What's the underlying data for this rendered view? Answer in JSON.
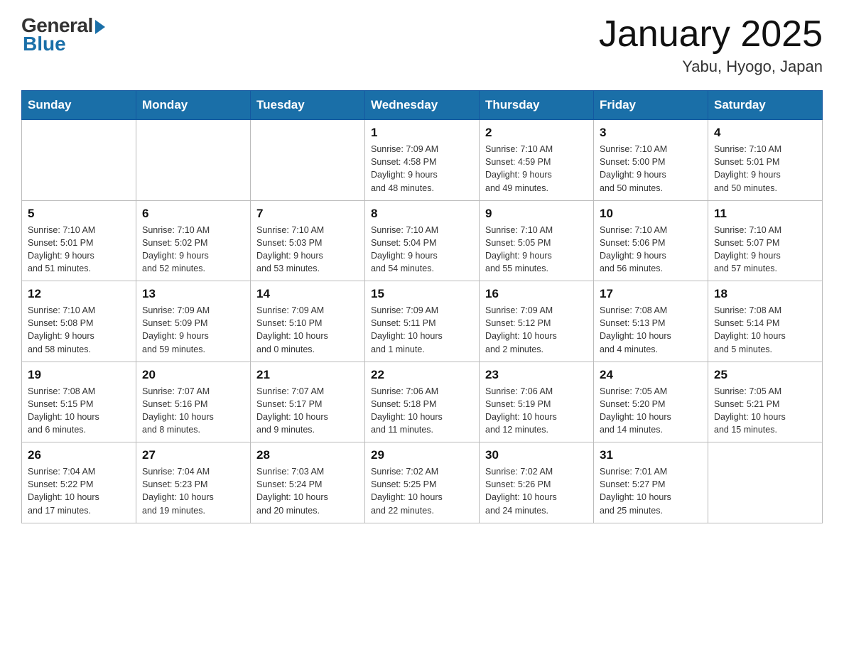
{
  "header": {
    "logo_general": "General",
    "logo_blue": "Blue",
    "title": "January 2025",
    "location": "Yabu, Hyogo, Japan"
  },
  "days_of_week": [
    "Sunday",
    "Monday",
    "Tuesday",
    "Wednesday",
    "Thursday",
    "Friday",
    "Saturday"
  ],
  "weeks": [
    [
      {
        "day": "",
        "info": ""
      },
      {
        "day": "",
        "info": ""
      },
      {
        "day": "",
        "info": ""
      },
      {
        "day": "1",
        "info": "Sunrise: 7:09 AM\nSunset: 4:58 PM\nDaylight: 9 hours\nand 48 minutes."
      },
      {
        "day": "2",
        "info": "Sunrise: 7:10 AM\nSunset: 4:59 PM\nDaylight: 9 hours\nand 49 minutes."
      },
      {
        "day": "3",
        "info": "Sunrise: 7:10 AM\nSunset: 5:00 PM\nDaylight: 9 hours\nand 50 minutes."
      },
      {
        "day": "4",
        "info": "Sunrise: 7:10 AM\nSunset: 5:01 PM\nDaylight: 9 hours\nand 50 minutes."
      }
    ],
    [
      {
        "day": "5",
        "info": "Sunrise: 7:10 AM\nSunset: 5:01 PM\nDaylight: 9 hours\nand 51 minutes."
      },
      {
        "day": "6",
        "info": "Sunrise: 7:10 AM\nSunset: 5:02 PM\nDaylight: 9 hours\nand 52 minutes."
      },
      {
        "day": "7",
        "info": "Sunrise: 7:10 AM\nSunset: 5:03 PM\nDaylight: 9 hours\nand 53 minutes."
      },
      {
        "day": "8",
        "info": "Sunrise: 7:10 AM\nSunset: 5:04 PM\nDaylight: 9 hours\nand 54 minutes."
      },
      {
        "day": "9",
        "info": "Sunrise: 7:10 AM\nSunset: 5:05 PM\nDaylight: 9 hours\nand 55 minutes."
      },
      {
        "day": "10",
        "info": "Sunrise: 7:10 AM\nSunset: 5:06 PM\nDaylight: 9 hours\nand 56 minutes."
      },
      {
        "day": "11",
        "info": "Sunrise: 7:10 AM\nSunset: 5:07 PM\nDaylight: 9 hours\nand 57 minutes."
      }
    ],
    [
      {
        "day": "12",
        "info": "Sunrise: 7:10 AM\nSunset: 5:08 PM\nDaylight: 9 hours\nand 58 minutes."
      },
      {
        "day": "13",
        "info": "Sunrise: 7:09 AM\nSunset: 5:09 PM\nDaylight: 9 hours\nand 59 minutes."
      },
      {
        "day": "14",
        "info": "Sunrise: 7:09 AM\nSunset: 5:10 PM\nDaylight: 10 hours\nand 0 minutes."
      },
      {
        "day": "15",
        "info": "Sunrise: 7:09 AM\nSunset: 5:11 PM\nDaylight: 10 hours\nand 1 minute."
      },
      {
        "day": "16",
        "info": "Sunrise: 7:09 AM\nSunset: 5:12 PM\nDaylight: 10 hours\nand 2 minutes."
      },
      {
        "day": "17",
        "info": "Sunrise: 7:08 AM\nSunset: 5:13 PM\nDaylight: 10 hours\nand 4 minutes."
      },
      {
        "day": "18",
        "info": "Sunrise: 7:08 AM\nSunset: 5:14 PM\nDaylight: 10 hours\nand 5 minutes."
      }
    ],
    [
      {
        "day": "19",
        "info": "Sunrise: 7:08 AM\nSunset: 5:15 PM\nDaylight: 10 hours\nand 6 minutes."
      },
      {
        "day": "20",
        "info": "Sunrise: 7:07 AM\nSunset: 5:16 PM\nDaylight: 10 hours\nand 8 minutes."
      },
      {
        "day": "21",
        "info": "Sunrise: 7:07 AM\nSunset: 5:17 PM\nDaylight: 10 hours\nand 9 minutes."
      },
      {
        "day": "22",
        "info": "Sunrise: 7:06 AM\nSunset: 5:18 PM\nDaylight: 10 hours\nand 11 minutes."
      },
      {
        "day": "23",
        "info": "Sunrise: 7:06 AM\nSunset: 5:19 PM\nDaylight: 10 hours\nand 12 minutes."
      },
      {
        "day": "24",
        "info": "Sunrise: 7:05 AM\nSunset: 5:20 PM\nDaylight: 10 hours\nand 14 minutes."
      },
      {
        "day": "25",
        "info": "Sunrise: 7:05 AM\nSunset: 5:21 PM\nDaylight: 10 hours\nand 15 minutes."
      }
    ],
    [
      {
        "day": "26",
        "info": "Sunrise: 7:04 AM\nSunset: 5:22 PM\nDaylight: 10 hours\nand 17 minutes."
      },
      {
        "day": "27",
        "info": "Sunrise: 7:04 AM\nSunset: 5:23 PM\nDaylight: 10 hours\nand 19 minutes."
      },
      {
        "day": "28",
        "info": "Sunrise: 7:03 AM\nSunset: 5:24 PM\nDaylight: 10 hours\nand 20 minutes."
      },
      {
        "day": "29",
        "info": "Sunrise: 7:02 AM\nSunset: 5:25 PM\nDaylight: 10 hours\nand 22 minutes."
      },
      {
        "day": "30",
        "info": "Sunrise: 7:02 AM\nSunset: 5:26 PM\nDaylight: 10 hours\nand 24 minutes."
      },
      {
        "day": "31",
        "info": "Sunrise: 7:01 AM\nSunset: 5:27 PM\nDaylight: 10 hours\nand 25 minutes."
      },
      {
        "day": "",
        "info": ""
      }
    ]
  ]
}
